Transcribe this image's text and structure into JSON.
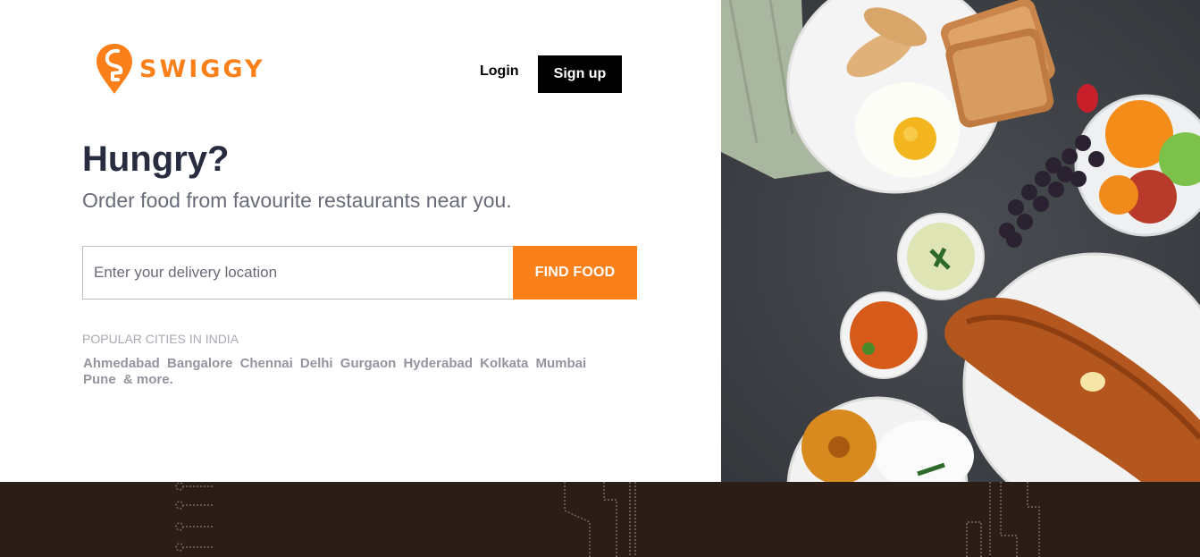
{
  "brand": {
    "name": "SWIGGY",
    "logo_icon": "swiggy-logo-icon",
    "accent_color": "#fc8019"
  },
  "header": {
    "login_label": "Login",
    "signup_label": "Sign up"
  },
  "hero": {
    "title": "Hungry?",
    "subtitle": "Order food from favourite restaurants near you."
  },
  "search": {
    "placeholder": "Enter your delivery location",
    "value": "",
    "button_label": "FIND FOOD"
  },
  "popular": {
    "title": "POPULAR CITIES IN INDIA",
    "cities": [
      "Ahmedabad",
      "Bangalore",
      "Chennai",
      "Delhi",
      "Gurgaon",
      "Hyderabad",
      "Kolkata",
      "Mumbai",
      "Pune"
    ],
    "more_label": "& more."
  },
  "colors": {
    "primary": "#fc8019",
    "dark_button": "#000000",
    "footer_bg": "#2b1e16",
    "heading": "#282c3f"
  }
}
